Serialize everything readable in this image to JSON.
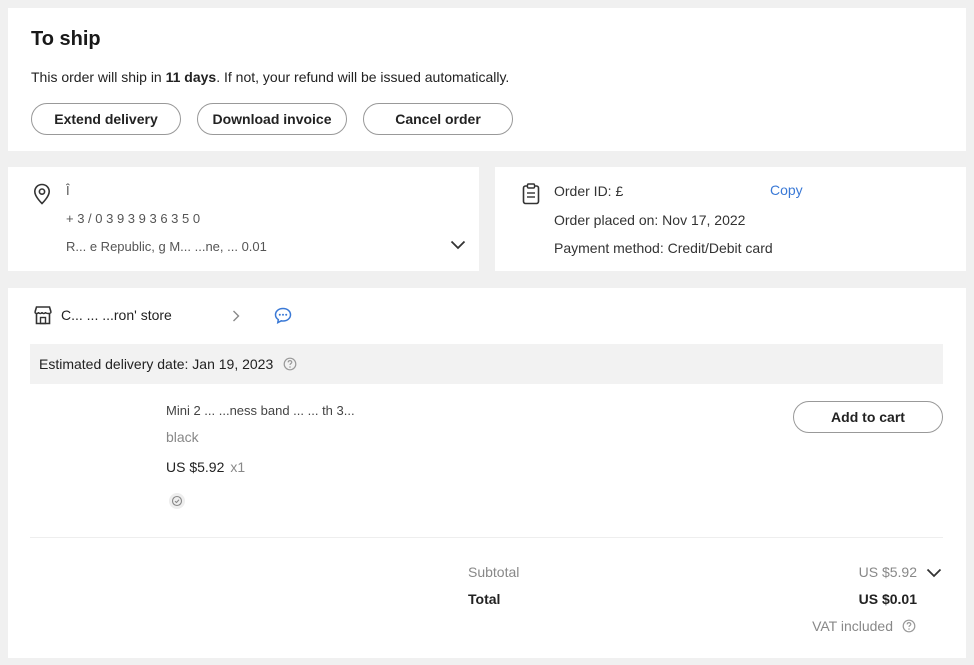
{
  "ship": {
    "title": "To ship",
    "message_prefix": "This order will ship in ",
    "message_bold": "11 days",
    "message_suffix": ". If not, your refund will be issued automatically.",
    "buttons": {
      "extend": "Extend delivery",
      "invoice": "Download invoice",
      "cancel": "Cancel order"
    }
  },
  "address": {
    "line1": "Î",
    "line2": "+ 3 / 0 3 9 3 9 3 6 3 5 0",
    "line3": "R... e Republic, g M...  ...ne, ... 0.01"
  },
  "order": {
    "id_label": "Order ID: £",
    "copy_label": "Copy",
    "placed_label": "Order placed on: Nov 17, 2022",
    "payment_label": "Payment method: Credit/Debit card"
  },
  "store": {
    "name": "C...  ...   ...ron' store",
    "delivery_label": "Estimated delivery date: Jan 19, 2023",
    "product": {
      "title": "Mini 2 ...  ...ness band ...  ... th 3... ",
      "variant": "black",
      "price": "US $5.92",
      "qty": "x1"
    },
    "add_to_cart": "Add to cart"
  },
  "summary": {
    "subtotal_label": "Subtotal",
    "subtotal_value": "US $5.92",
    "total_label": "Total",
    "total_value": "US $0.01",
    "vat_label": "VAT included"
  },
  "colors": {
    "link": "#3a79d6",
    "chat_icon": "#3a79d6",
    "muted": "#888888"
  }
}
